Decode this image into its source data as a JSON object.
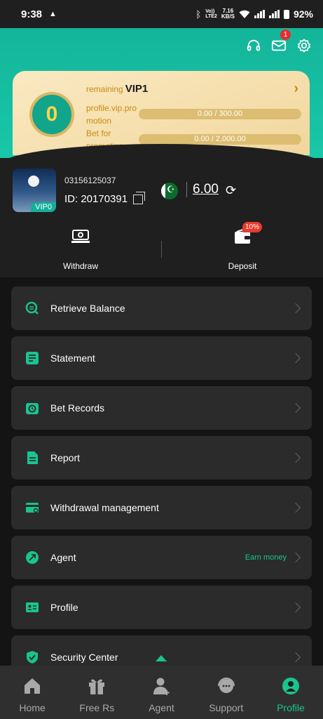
{
  "status_bar": {
    "time": "9:38",
    "network_speed_value": "7.16",
    "network_speed_unit": "KB/S",
    "volte_label": "Vo))",
    "lte_label": "LTE2",
    "battery": "92%"
  },
  "header": {
    "mail_badge": "1"
  },
  "vip_card": {
    "medal_level": "0",
    "remaining_label": "remaining",
    "next_level": "VIP1",
    "promotion_label": "profile.vip.promotion",
    "promotion_progress": "0.00 / 300.00",
    "bet_label": "Bet for promotion",
    "bet_progress": "0.00 / 2,000.00"
  },
  "user": {
    "vip_badge": "VIP0",
    "phone": "03156125037",
    "id": "ID: 20170391",
    "balance": "6.00"
  },
  "actions": {
    "withdraw": "Withdraw",
    "deposit": "Deposit",
    "deposit_badge": "10%"
  },
  "menu": [
    {
      "label": "Retrieve Balance",
      "extra": ""
    },
    {
      "label": "Statement",
      "extra": ""
    },
    {
      "label": "Bet Records",
      "extra": ""
    },
    {
      "label": "Report",
      "extra": ""
    },
    {
      "label": "Withdrawal management",
      "extra": ""
    },
    {
      "label": "Agent",
      "extra": "Earn money"
    },
    {
      "label": "Profile",
      "extra": ""
    },
    {
      "label": "Security Center",
      "extra": ""
    }
  ],
  "bottom_nav": [
    {
      "label": "Home",
      "icon": "home-icon"
    },
    {
      "label": "Free Rs",
      "icon": "gift-icon"
    },
    {
      "label": "Agent",
      "icon": "agent-icon"
    },
    {
      "label": "Support",
      "icon": "support-icon"
    },
    {
      "label": "Profile",
      "icon": "profile-icon",
      "active": true
    }
  ],
  "colors": {
    "accent": "#19c48f",
    "header_teal": "#14b59a",
    "vip_gold": "#c98a12"
  }
}
